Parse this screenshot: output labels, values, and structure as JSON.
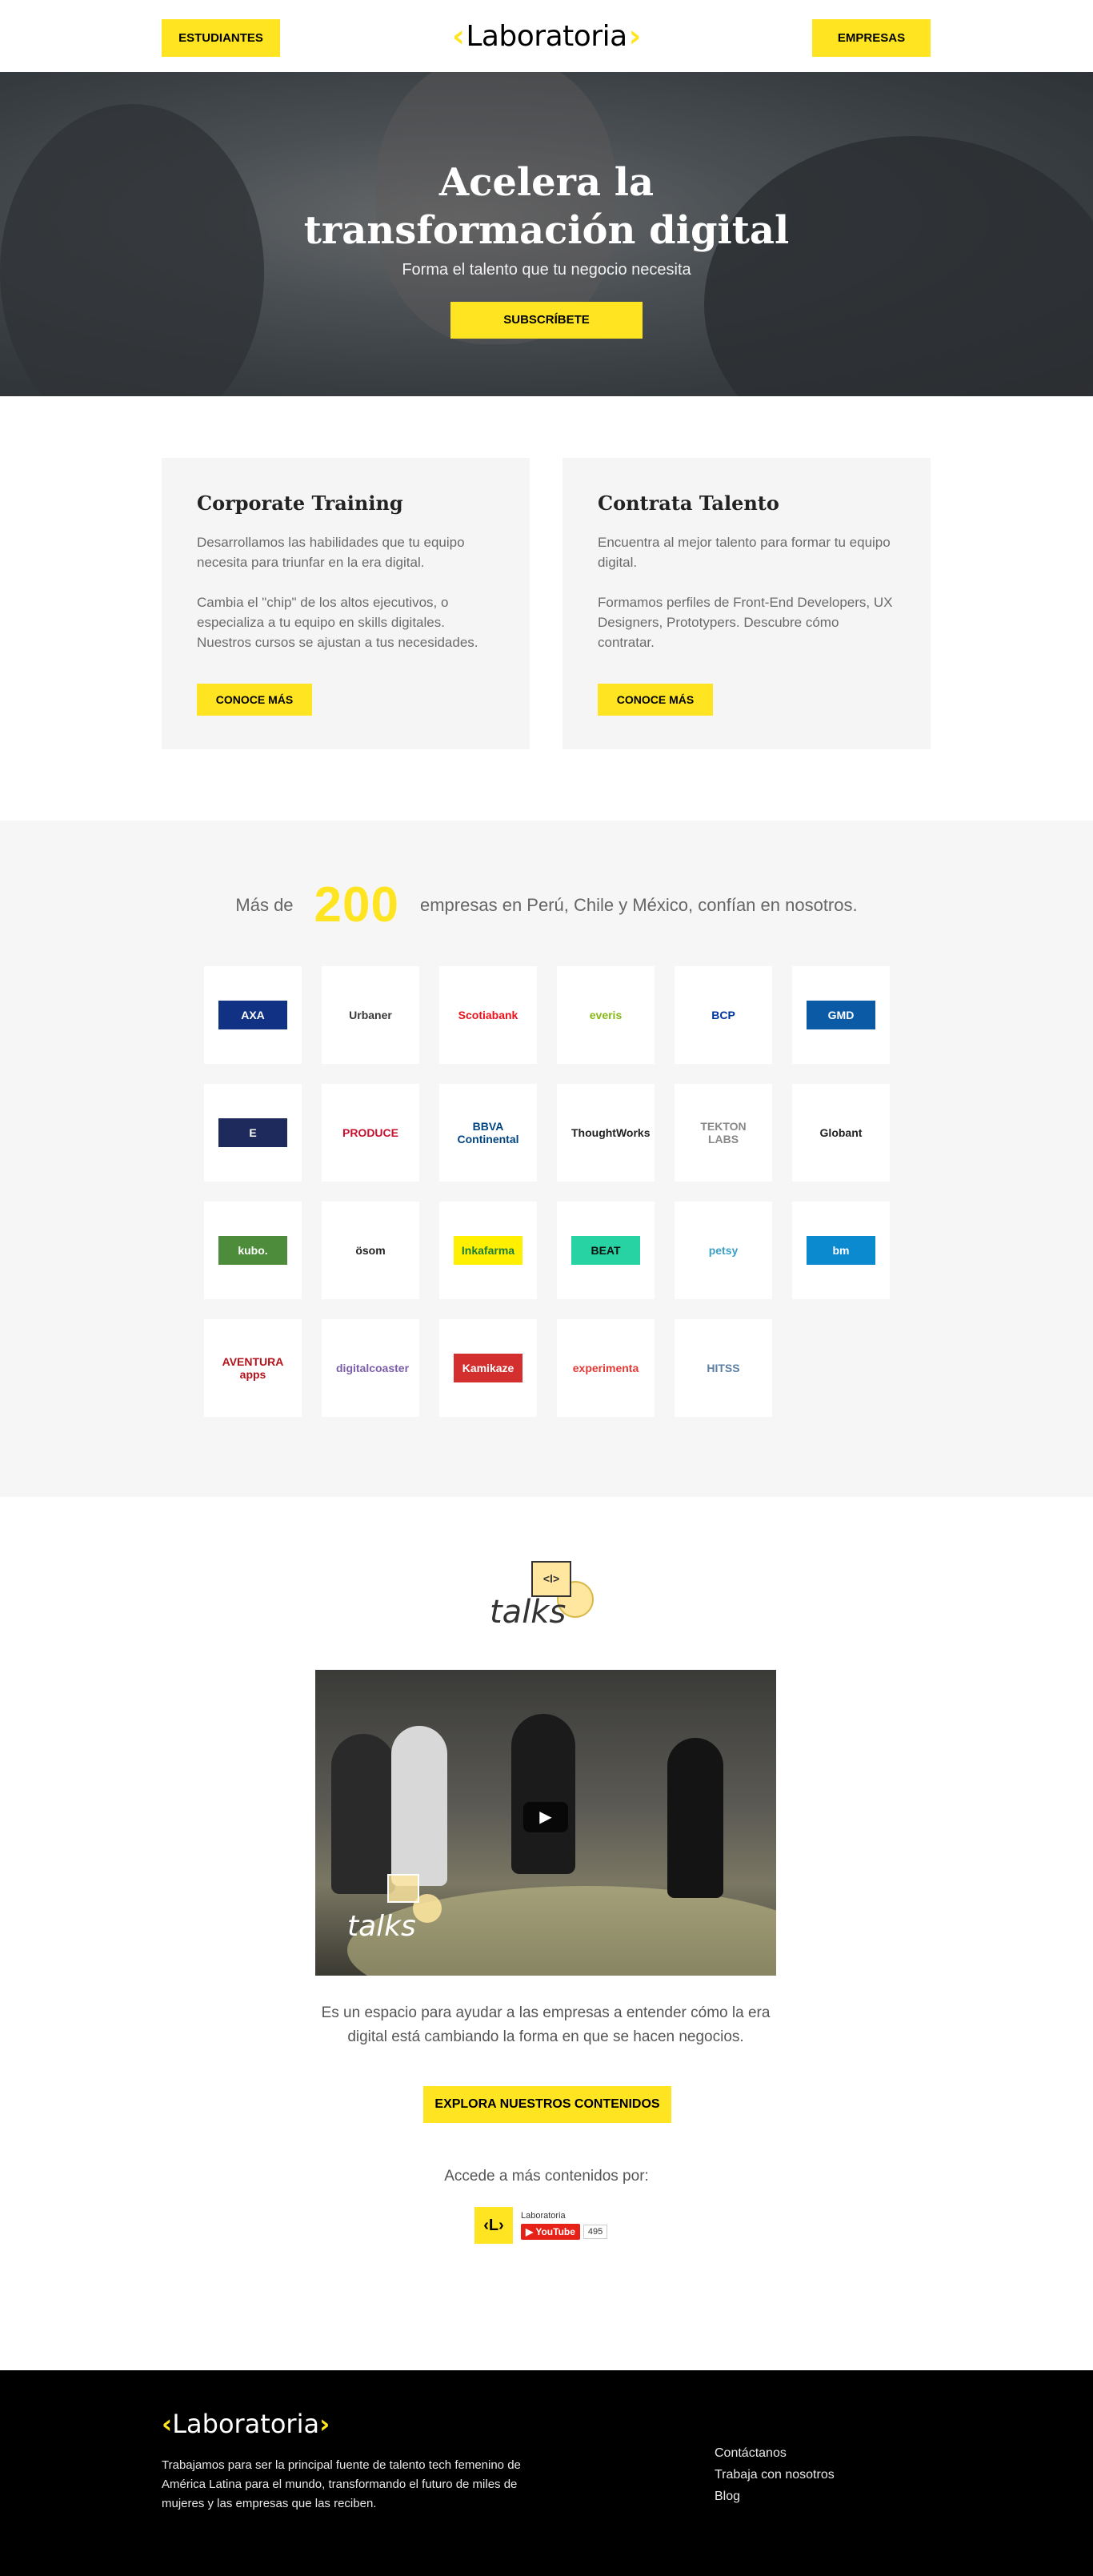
{
  "header": {
    "students_label": "ESTUDIANTES",
    "companies_label": "EMPRESAS",
    "logo_text": "Laboratoria"
  },
  "hero": {
    "title_line1": "Acelera la",
    "title_line2": "transformación digital",
    "subtitle": "Forma el talento que tu negocio necesita",
    "cta_label": "SUBSCRÍBETE"
  },
  "cards": [
    {
      "title": "Corporate Training",
      "p1": "Desarrollamos las habilidades que tu equipo necesita para triunfar en la era digital.",
      "p2": "Cambia el \"chip\" de los altos ejecutivos, o especializa a tu equipo en skills digitales. Nuestros cursos se ajustan a tus necesidades.",
      "button_label": "CONOCE MÁS"
    },
    {
      "title": "Contrata Talento",
      "p1": "Encuentra al mejor talento para formar tu equipo digital.",
      "p2": "Formamos perfiles de Front-End Developers, UX Designers, Prototypers. Descubre cómo contratar.",
      "button_label": "CONOCE MÁS"
    }
  ],
  "companies": {
    "prefix": "Más de",
    "count": "200",
    "suffix": "empresas en Perú, Chile y México, confían en nosotros.",
    "logos": [
      {
        "name": "AXA",
        "bg": "#103184",
        "fg": "#ffffff"
      },
      {
        "name": "Urbaner",
        "bg": "#ffffff",
        "fg": "#3a3a3a"
      },
      {
        "name": "Scotiabank",
        "bg": "#ffffff",
        "fg": "#ec111a"
      },
      {
        "name": "everis",
        "bg": "#ffffff",
        "fg": "#86b817"
      },
      {
        "name": "BCP",
        "bg": "#ffffff",
        "fg": "#0033a0"
      },
      {
        "name": "GMD",
        "bg": "#0b5aa6",
        "fg": "#ffffff"
      },
      {
        "name": "E",
        "bg": "#1f2a5c",
        "fg": "#ffffff"
      },
      {
        "name": "PRODUCE",
        "bg": "#ffffff",
        "fg": "#c8102e"
      },
      {
        "name": "BBVA Continental",
        "bg": "#ffffff",
        "fg": "#004481"
      },
      {
        "name": "ThoughtWorks",
        "bg": "#ffffff",
        "fg": "#222222"
      },
      {
        "name": "TEKTON LABS",
        "bg": "#ffffff",
        "fg": "#888888"
      },
      {
        "name": "Globant",
        "bg": "#ffffff",
        "fg": "#222222"
      },
      {
        "name": "kubo.",
        "bg": "#4d8c3a",
        "fg": "#ffffff"
      },
      {
        "name": "ösom",
        "bg": "#ffffff",
        "fg": "#222222"
      },
      {
        "name": "Inkafarma",
        "bg": "#ffef00",
        "fg": "#1a7f3c"
      },
      {
        "name": "BEAT",
        "bg": "#27d3a3",
        "fg": "#111111"
      },
      {
        "name": "petsy",
        "bg": "#ffffff",
        "fg": "#3aa0c8"
      },
      {
        "name": "bm",
        "bg": "#0c8ad0",
        "fg": "#ffffff"
      },
      {
        "name": "AVENTURA apps",
        "bg": "#ffffff",
        "fg": "#b5121b"
      },
      {
        "name": "digitalcoaster",
        "bg": "#ffffff",
        "fg": "#7b5ea7"
      },
      {
        "name": "Kamikaze",
        "bg": "#d32f2f",
        "fg": "#ffffff"
      },
      {
        "name": "experimenta",
        "bg": "#ffffff",
        "fg": "#e53935"
      },
      {
        "name": "HITSS",
        "bg": "#ffffff",
        "fg": "#5b7fa5"
      }
    ]
  },
  "talks": {
    "logo_word": "talks",
    "description": "Es un espacio para ayudar a las empresas a entender cómo la era digital está cambiando la forma en que se hacen negocios.",
    "explore_label": "EXPLORA NUESTROS CONTENIDOS",
    "more_label": "Accede a más contenidos por:",
    "channel_name": "Laboratoria",
    "youtube_label": "YouTube",
    "subscriber_count": "495"
  },
  "footer": {
    "logo_text": "Laboratoria",
    "description": "Trabajamos para ser la principal fuente de talento tech femenino de América Latina para el mundo, transformando el futuro de miles de mujeres y las empresas que las reciben.",
    "links": [
      "Contáctanos",
      "Trabaja con nosotros",
      "Blog"
    ]
  },
  "colors": {
    "accent": "#ffe521",
    "footer_bg": "#000000",
    "section_bg": "#f6f6f6"
  }
}
